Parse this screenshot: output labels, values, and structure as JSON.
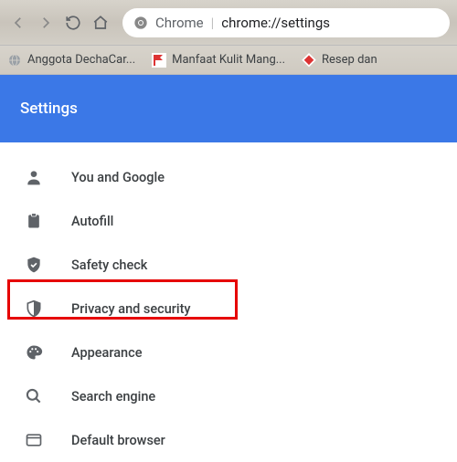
{
  "toolbar": {
    "omnibox": {
      "siteLabel": "Chrome",
      "url": "chrome://settings"
    }
  },
  "bookmarks": [
    {
      "label": "Anggota DechaCar...",
      "icon": "globe"
    },
    {
      "label": "Manfaat Kulit Mang...",
      "icon": "redflag"
    },
    {
      "label": "Resep dan",
      "icon": "diamond"
    }
  ],
  "header": {
    "title": "Settings"
  },
  "settings": [
    {
      "key": "you-google",
      "label": "You and Google",
      "icon": "person"
    },
    {
      "key": "autofill",
      "label": "Autofill",
      "icon": "clipboard"
    },
    {
      "key": "safety-check",
      "label": "Safety check",
      "icon": "shield-check"
    },
    {
      "key": "privacy-security",
      "label": "Privacy and security",
      "icon": "shield-half",
      "highlighted": true
    },
    {
      "key": "appearance",
      "label": "Appearance",
      "icon": "palette"
    },
    {
      "key": "search-engine",
      "label": "Search engine",
      "icon": "search"
    },
    {
      "key": "default-browser",
      "label": "Default browser",
      "icon": "browser"
    }
  ],
  "colors": {
    "accent": "#3b78e7",
    "highlight": "#e60000"
  }
}
